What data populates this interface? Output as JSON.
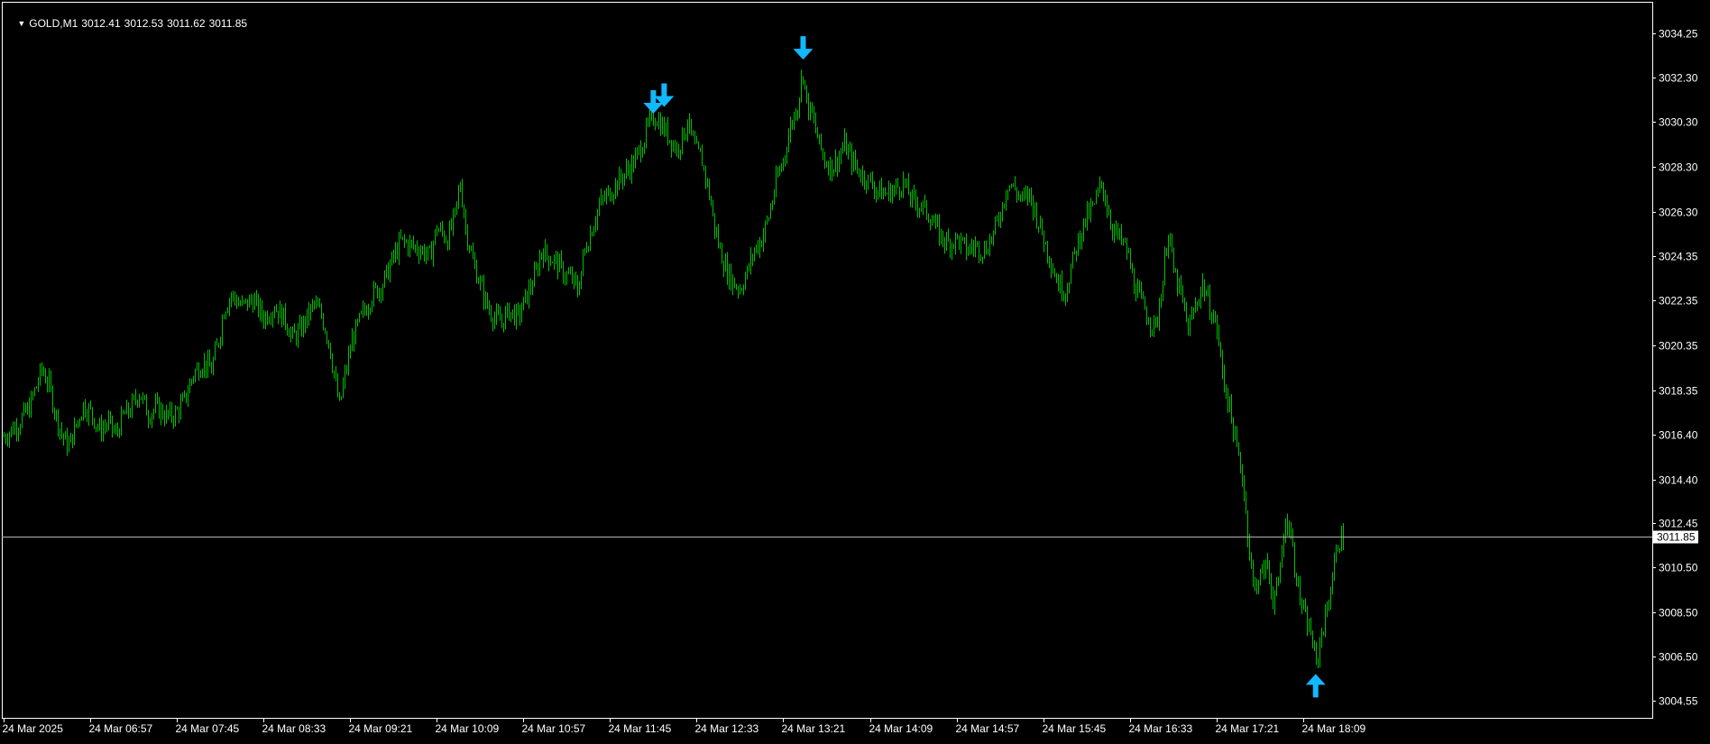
{
  "window": {
    "symbol": "GOLD,M1",
    "ohlc": [
      "3012.41",
      "3012.53",
      "3011.62",
      "3011.85"
    ],
    "dropdown_icon": "triangle-down-icon"
  },
  "colors": {
    "background": "#000000",
    "frame": "#ffffff",
    "candles": "#00c000",
    "bid_line": "#b4b4b4",
    "arrows": "#12b8ff",
    "text": "#ffffff"
  },
  "chart_data": {
    "type": "line",
    "timeframe": "M1",
    "y_axis": {
      "ticks": [
        "3034.25",
        "3032.30",
        "3030.30",
        "3028.30",
        "3026.30",
        "3024.35",
        "3022.35",
        "3020.35",
        "3018.35",
        "3016.40",
        "3014.40",
        "3012.45",
        "3010.50",
        "3008.50",
        "3006.50",
        "3004.55"
      ],
      "range": [
        3003.5,
        3035.7
      ]
    },
    "x_axis": {
      "ticks": [
        "24 Mar 2025",
        "24 Mar 06:57",
        "24 Mar 07:45",
        "24 Mar 08:33",
        "24 Mar 09:21",
        "24 Mar 10:09",
        "24 Mar 10:57",
        "24 Mar 11:45",
        "24 Mar 12:33",
        "24 Mar 13:21",
        "24 Mar 14:09",
        "24 Mar 14:57",
        "24 Mar 15:45",
        "24 Mar 16:33",
        "24 Mar 17:21",
        "24 Mar 18:09"
      ],
      "minutes_per_tick": 48
    },
    "current_price": "3011.85",
    "series": [
      {
        "values": [
          [
            0,
            3016.3
          ],
          [
            8,
            3016.9
          ],
          [
            14,
            3017.6
          ],
          [
            19,
            3018.8
          ],
          [
            21,
            3019.3
          ],
          [
            25,
            3018.6
          ],
          [
            29,
            3017.2
          ],
          [
            33,
            3016.2
          ],
          [
            36,
            3015.9
          ],
          [
            40,
            3016.8
          ],
          [
            44,
            3017.7
          ],
          [
            48,
            3017.4
          ],
          [
            53,
            3016.6
          ],
          [
            58,
            3016.9
          ],
          [
            62,
            3016.4
          ],
          [
            66,
            3017.2
          ],
          [
            70,
            3017.5
          ],
          [
            75,
            3018.3
          ],
          [
            80,
            3017.3
          ],
          [
            85,
            3017.6
          ],
          [
            90,
            3017.2
          ],
          [
            95,
            3017.3
          ],
          [
            100,
            3017.9
          ],
          [
            105,
            3019.1
          ],
          [
            110,
            3019.6
          ],
          [
            115,
            3019.3
          ],
          [
            119,
            3020.6
          ],
          [
            122,
            3022.0
          ],
          [
            126,
            3022.6
          ],
          [
            132,
            3022.1
          ],
          [
            138,
            3022.4
          ],
          [
            144,
            3021.6
          ],
          [
            150,
            3022.1
          ],
          [
            156,
            3021.5
          ],
          [
            160,
            3020.7
          ],
          [
            164,
            3021.0
          ],
          [
            168,
            3021.6
          ],
          [
            172,
            3022.2
          ],
          [
            176,
            3021.7
          ],
          [
            180,
            3020.6
          ],
          [
            184,
            3018.6
          ],
          [
            186,
            3017.6
          ],
          [
            188,
            3018.6
          ],
          [
            193,
            3020.6
          ],
          [
            198,
            3021.6
          ],
          [
            204,
            3022.6
          ],
          [
            210,
            3023.1
          ],
          [
            215,
            3024.1
          ],
          [
            220,
            3025.0
          ],
          [
            226,
            3024.8
          ],
          [
            232,
            3024.6
          ],
          [
            236,
            3024.3
          ],
          [
            240,
            3025.6
          ],
          [
            246,
            3025.1
          ],
          [
            250,
            3026.1
          ],
          [
            253,
            3027.6
          ],
          [
            256,
            3025.6
          ],
          [
            260,
            3024.1
          ],
          [
            264,
            3023.1
          ],
          [
            268,
            3022.1
          ],
          [
            272,
            3021.6
          ],
          [
            276,
            3021.4
          ],
          [
            280,
            3021.9
          ],
          [
            285,
            3021.6
          ],
          [
            290,
            3022.6
          ],
          [
            295,
            3023.6
          ],
          [
            298,
            3024.6
          ],
          [
            302,
            3024.3
          ],
          [
            306,
            3024.1
          ],
          [
            310,
            3023.6
          ],
          [
            315,
            3023.3
          ],
          [
            318,
            3022.8
          ],
          [
            322,
            3024.6
          ],
          [
            326,
            3025.6
          ],
          [
            330,
            3026.6
          ],
          [
            335,
            3027.1
          ],
          [
            340,
            3027.6
          ],
          [
            345,
            3028.1
          ],
          [
            350,
            3028.6
          ],
          [
            355,
            3029.6
          ],
          [
            358,
            3030.3
          ],
          [
            361,
            3030.6
          ],
          [
            365,
            3030.1
          ],
          [
            369,
            3029.6
          ],
          [
            373,
            3029.1
          ],
          [
            376,
            3029.6
          ],
          [
            379,
            3030.3
          ],
          [
            383,
            3029.1
          ],
          [
            387,
            3028.6
          ],
          [
            391,
            3027.1
          ],
          [
            394,
            3025.6
          ],
          [
            397,
            3024.6
          ],
          [
            401,
            3023.6
          ],
          [
            405,
            3023.1
          ],
          [
            408,
            3022.9
          ],
          [
            412,
            3023.6
          ],
          [
            416,
            3024.6
          ],
          [
            420,
            3025.1
          ],
          [
            424,
            3026.1
          ],
          [
            428,
            3027.6
          ],
          [
            432,
            3028.6
          ],
          [
            436,
            3030.1
          ],
          [
            440,
            3031.1
          ],
          [
            443,
            3032.6
          ],
          [
            445,
            3031.1
          ],
          [
            448,
            3030.6
          ],
          [
            452,
            3029.3
          ],
          [
            455,
            3028.6
          ],
          [
            459,
            3028.3
          ],
          [
            462,
            3028.6
          ],
          [
            466,
            3029.3
          ],
          [
            470,
            3028.6
          ],
          [
            474,
            3028.1
          ],
          [
            478,
            3027.8
          ],
          [
            483,
            3027.3
          ],
          [
            488,
            3027.1
          ],
          [
            493,
            3027.3
          ],
          [
            498,
            3027.6
          ],
          [
            503,
            3026.8
          ],
          [
            508,
            3026.6
          ],
          [
            513,
            3026.1
          ],
          [
            518,
            3025.3
          ],
          [
            523,
            3024.9
          ],
          [
            528,
            3025.1
          ],
          [
            533,
            3024.6
          ],
          [
            538,
            3024.8
          ],
          [
            543,
            3024.6
          ],
          [
            548,
            3025.3
          ],
          [
            553,
            3026.6
          ],
          [
            556,
            3027.6
          ],
          [
            560,
            3027.3
          ],
          [
            564,
            3026.8
          ],
          [
            568,
            3027.1
          ],
          [
            572,
            3026.1
          ],
          [
            576,
            3025.1
          ],
          [
            580,
            3024.1
          ],
          [
            584,
            3023.1
          ],
          [
            588,
            3022.8
          ],
          [
            592,
            3024.1
          ],
          [
            596,
            3025.3
          ],
          [
            600,
            3026.1
          ],
          [
            604,
            3026.6
          ],
          [
            608,
            3027.6
          ],
          [
            611,
            3026.6
          ],
          [
            614,
            3025.6
          ],
          [
            618,
            3025.1
          ],
          [
            622,
            3024.6
          ],
          [
            626,
            3023.1
          ],
          [
            630,
            3022.3
          ],
          [
            634,
            3021.6
          ],
          [
            638,
            3021.1
          ],
          [
            642,
            3023.3
          ],
          [
            645,
            3025.6
          ],
          [
            648,
            3023.6
          ],
          [
            652,
            3022.6
          ],
          [
            656,
            3021.1
          ],
          [
            660,
            3022.1
          ],
          [
            664,
            3023.1
          ],
          [
            668,
            3022.1
          ],
          [
            672,
            3021.1
          ],
          [
            675,
            3019.1
          ],
          [
            679,
            3017.6
          ],
          [
            682,
            3016.1
          ],
          [
            686,
            3014.6
          ],
          [
            689,
            3012.1
          ],
          [
            692,
            3009.6
          ],
          [
            696,
            3010.1
          ],
          [
            700,
            3010.6
          ],
          [
            703,
            3009.1
          ],
          [
            706,
            3009.6
          ],
          [
            709,
            3012.1
          ],
          [
            712,
            3012.6
          ],
          [
            715,
            3010.6
          ],
          [
            718,
            3009.1
          ],
          [
            721,
            3008.1
          ],
          [
            724,
            3007.6
          ],
          [
            726,
            3006.6
          ],
          [
            727,
            3006.1
          ],
          [
            730,
            3007.6
          ],
          [
            733,
            3008.6
          ],
          [
            736,
            3010.1
          ],
          [
            739,
            3011.6
          ],
          [
            742,
            3011.85
          ]
        ]
      }
    ],
    "signals": [
      {
        "type": "sell",
        "at": 360,
        "price": 3030.6
      },
      {
        "type": "sell",
        "at": 366,
        "price": 3030.9
      },
      {
        "type": "sell",
        "at": 443,
        "price": 3033.0
      },
      {
        "type": "buy",
        "at": 727,
        "price": 3005.5
      }
    ]
  }
}
